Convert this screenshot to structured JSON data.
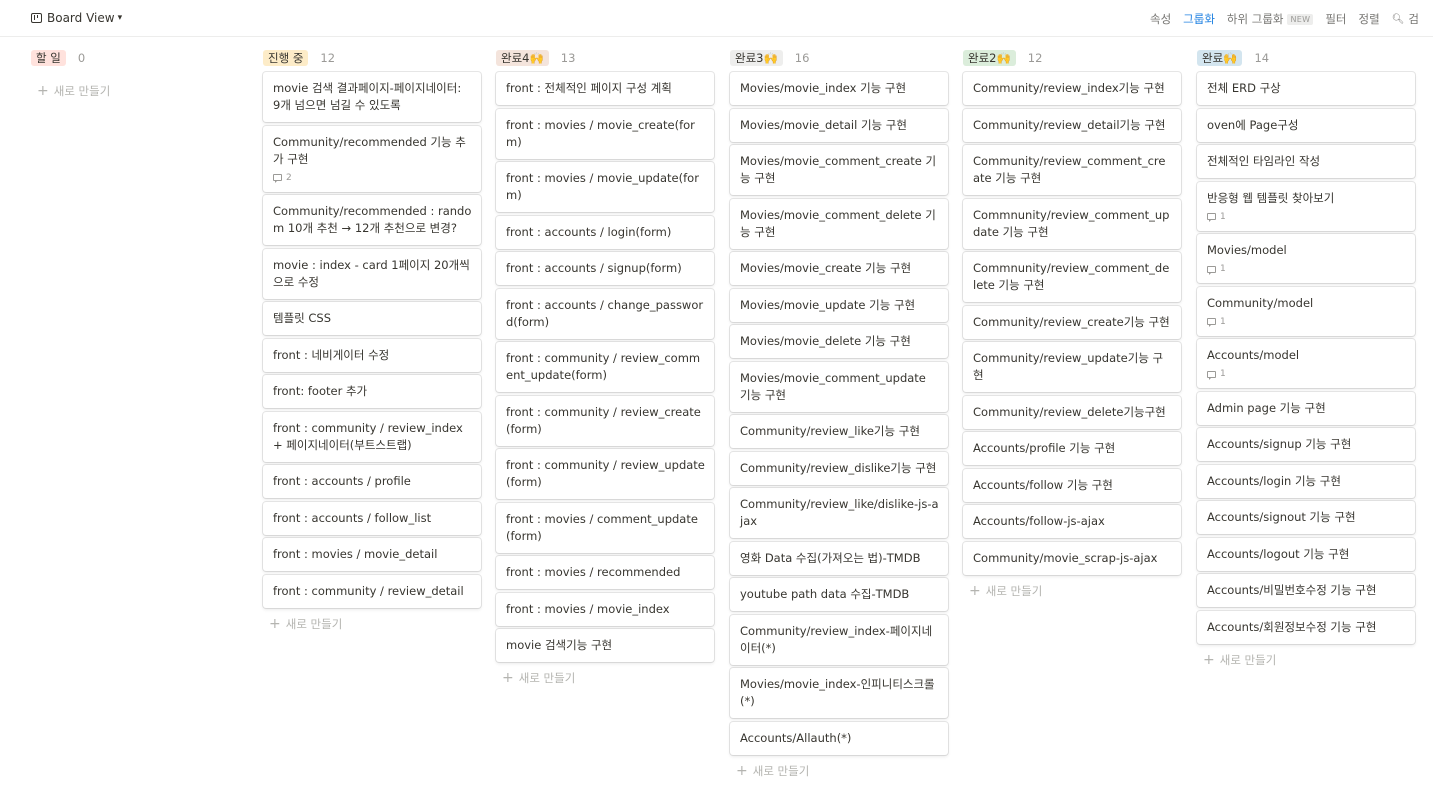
{
  "header": {
    "view_title": "Board View",
    "toolbar": {
      "properties": "속성",
      "group": "그룹화",
      "subgroup": "하위 그룹화",
      "new_badge": "NEW",
      "filter": "필터",
      "sort": "정렬",
      "search": "검"
    }
  },
  "columns": [
    {
      "tag": "할 일",
      "tag_color": "#ffe2dd",
      "count": "0",
      "cards": [],
      "new_label": "새로 만들기"
    },
    {
      "tag": "진행 중",
      "tag_color": "#fdecc8",
      "count": "12",
      "new_label": "새로 만들기",
      "cards": [
        {
          "title": "movie 검색 결과페이지-페이지네이터: 9개 넘으면 넘길 수 있도록"
        },
        {
          "title": "Community/recommended 기능 추가 구현",
          "comments": "2"
        },
        {
          "title": "Community/recommended : random 10개 추천 → 12개 추천으로 변경?"
        },
        {
          "title": "movie : index - card 1페이지 20개씩으로 수정"
        },
        {
          "title": "템플릿 CSS"
        },
        {
          "title": "front : 네비게이터 수정"
        },
        {
          "title": "front: footer 추가"
        },
        {
          "title": "front : community / review_index + 페이지네이터(부트스트랩)"
        },
        {
          "title": "front : accounts / profile"
        },
        {
          "title": "front : accounts / follow_list"
        },
        {
          "title": "front : movies / movie_detail"
        },
        {
          "title": "front : community / review_detail"
        }
      ]
    },
    {
      "tag": "완료4🙌",
      "tag_color": "#f4e4dc",
      "count": "13",
      "new_label": "새로 만들기",
      "cards": [
        {
          "title": "front : 전체적인 페이지 구성 계획"
        },
        {
          "title": "front : movies / movie_create(form)"
        },
        {
          "title": "front : movies / movie_update(form)"
        },
        {
          "title": "front : accounts / login(form)"
        },
        {
          "title": "front : accounts / signup(form)"
        },
        {
          "title": "front : accounts / change_password(form)"
        },
        {
          "title": "front : community / review_comment_update(form)"
        },
        {
          "title": "front : community / review_create(form)"
        },
        {
          "title": "front : community / review_update(form)"
        },
        {
          "title": "front : movies / comment_update(form)"
        },
        {
          "title": "front : movies /  recommended"
        },
        {
          "title": "front : movies / movie_index"
        },
        {
          "title": "movie 검색기능 구현"
        }
      ]
    },
    {
      "tag": "완료3🙌",
      "tag_color": "#eeeeed",
      "count": "16",
      "new_label": "새로 만들기",
      "cards": [
        {
          "title": "Movies/movie_index 기능 구현"
        },
        {
          "title": "Movies/movie_detail 기능 구현"
        },
        {
          "title": "Movies/movie_comment_create 기능 구현"
        },
        {
          "title": "Movies/movie_comment_delete 기능 구현"
        },
        {
          "title": "Movies/movie_create 기능 구현"
        },
        {
          "title": "Movies/movie_update 기능 구현"
        },
        {
          "title": "Movies/movie_delete 기능 구현"
        },
        {
          "title": "Movies/movie_comment_update 기능 구현"
        },
        {
          "title": "Community/review_like기능 구현"
        },
        {
          "title": "Community/review_dislike기능 구현"
        },
        {
          "title": "Community/review_like/dislike-js-ajax"
        },
        {
          "title": "영화 Data 수집(가져오는 법)-TMDB"
        },
        {
          "title": "youtube path data 수집-TMDB"
        },
        {
          "title": "Community/review_index-페이지네이터(*)"
        },
        {
          "title": "Movies/movie_index-인피니티스크롤(*)"
        },
        {
          "title": "Accounts/Allauth(*)"
        }
      ]
    },
    {
      "tag": "완료2🙌",
      "tag_color": "#dbeddb",
      "count": "12",
      "new_label": "새로 만들기",
      "cards": [
        {
          "title": "Community/review_index기능 구현"
        },
        {
          "title": "Community/review_detail기능 구현"
        },
        {
          "title": "Community/review_comment_create 기능 구현"
        },
        {
          "title": "Commnunity/review_comment_update 기능 구현"
        },
        {
          "title": "Commnunity/review_comment_delete 기능 구현"
        },
        {
          "title": "Community/review_create기능 구현"
        },
        {
          "title": "Community/review_update기능 구현"
        },
        {
          "title": "Community/review_delete기능구현"
        },
        {
          "title": "Accounts/profile 기능 구현"
        },
        {
          "title": "Accounts/follow 기능 구현"
        },
        {
          "title": "Accounts/follow-js-ajax"
        },
        {
          "title": "Community/movie_scrap-js-ajax"
        }
      ]
    },
    {
      "tag": "완료🙌",
      "tag_color": "#d3e5ef",
      "count": "14",
      "new_label": "새로 만들기",
      "cards": [
        {
          "title": "전체 ERD 구상"
        },
        {
          "title": "oven에 Page구성"
        },
        {
          "title": "전체적인 타임라인 작성"
        },
        {
          "title": "반응형 웹 템플릿 찾아보기",
          "comments": "1"
        },
        {
          "title": "Movies/model",
          "comments": "1"
        },
        {
          "title": "Community/model",
          "comments": "1"
        },
        {
          "title": "Accounts/model",
          "comments": "1"
        },
        {
          "title": "Admin page 기능 구현"
        },
        {
          "title": "Accounts/signup 기능 구현"
        },
        {
          "title": "Accounts/login 기능 구현"
        },
        {
          "title": "Accounts/signout 기능 구현"
        },
        {
          "title": "Accounts/logout 기능 구현"
        },
        {
          "title": "Accounts/비밀번호수정 기능 구현"
        },
        {
          "title": "Accounts/회원정보수정 기능 구현"
        }
      ]
    }
  ]
}
